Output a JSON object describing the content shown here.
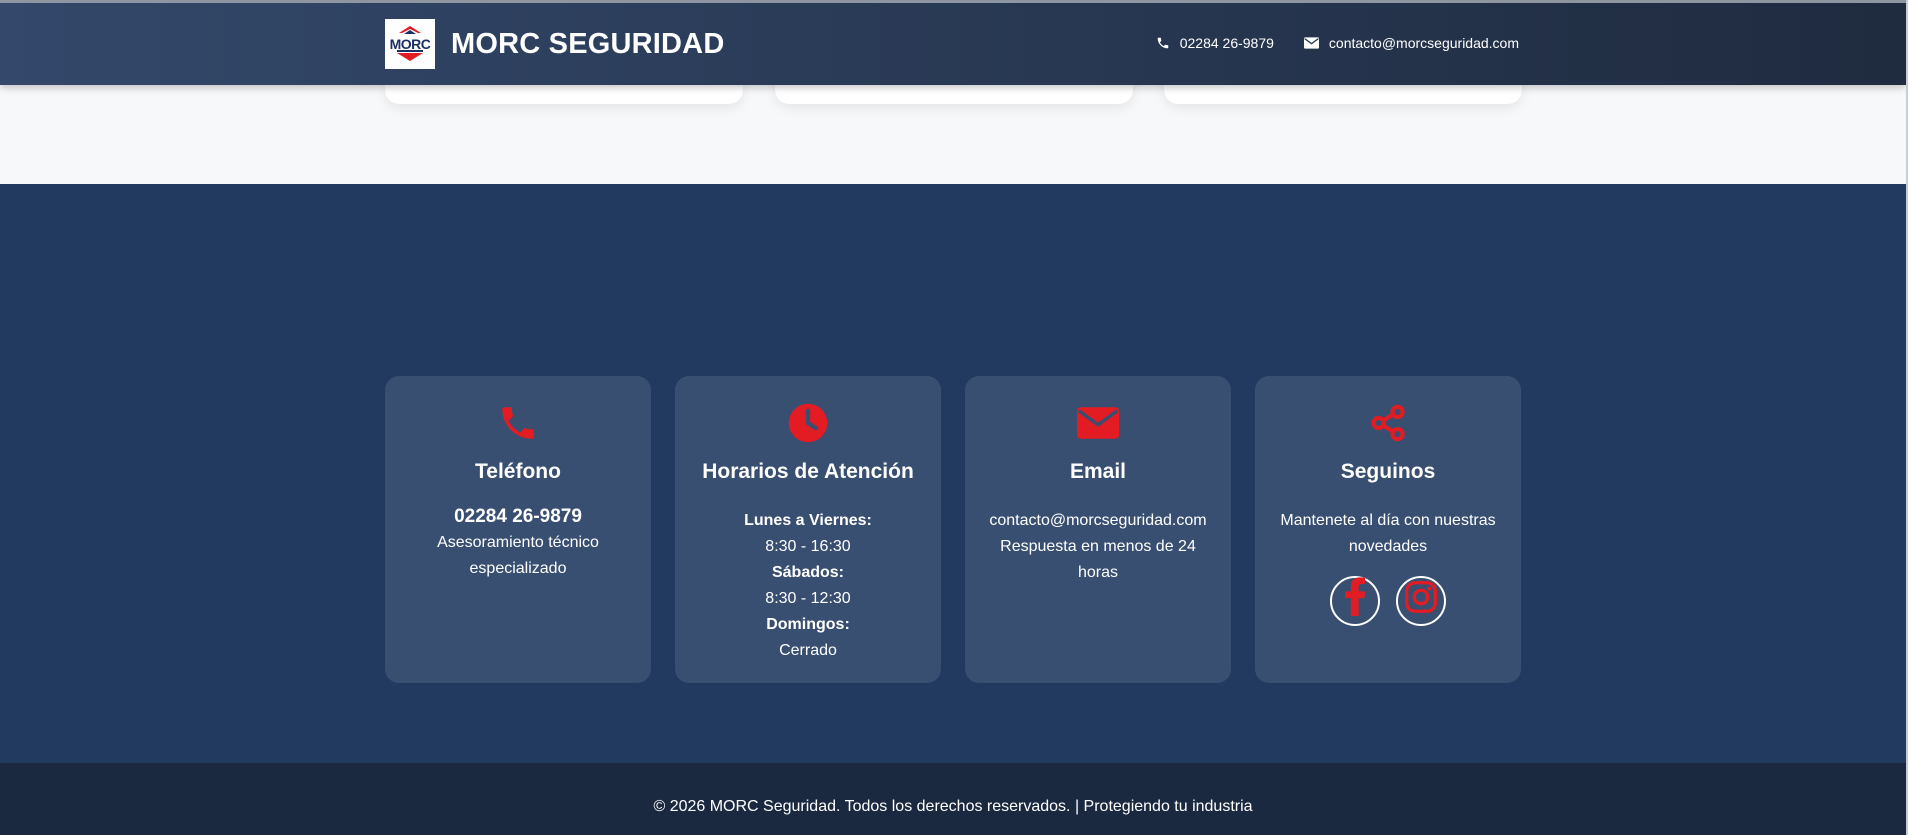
{
  "header": {
    "logo_text": "MORC",
    "brand_name": "MORC SEGURIDAD",
    "phone": "02284 26-9879",
    "email": "contacto@morcseguridad.com"
  },
  "cards": [
    {
      "icon": "phone-icon",
      "title": "Teléfono",
      "phone": "02284 26-9879",
      "lines": [
        "Asesoramiento técnico",
        "especializado"
      ]
    },
    {
      "icon": "clock-icon",
      "title": "Horarios de Atención",
      "schedule": [
        {
          "day": "Lunes a Viernes:",
          "hours": "8:30 - 16:30"
        },
        {
          "day": "Sábados:",
          "hours": "8:30 - 12:30"
        },
        {
          "day": "Domingos:",
          "hours": "Cerrado"
        }
      ]
    },
    {
      "icon": "envelope-icon",
      "title": "Email",
      "email": "contacto@morcseguridad.com",
      "lines": [
        "Respuesta en menos de 24",
        "horas"
      ]
    },
    {
      "icon": "share-icon",
      "title": "Seguinos",
      "lines": [
        "Mantenete al día con nuestras",
        "novedades"
      ],
      "socials": [
        "facebook-icon",
        "instagram-icon"
      ]
    }
  ],
  "footer": {
    "text": "© 2026 MORC Seguridad. Todos los derechos reservados. | Protegiendo tu industria"
  },
  "colors": {
    "accent": "#e31b23",
    "header_start": "#33486a",
    "header_end": "#1f2b3f",
    "section_bg": "#223a60",
    "card_bg": "#394f71",
    "footer_bg": "#1a2940"
  }
}
